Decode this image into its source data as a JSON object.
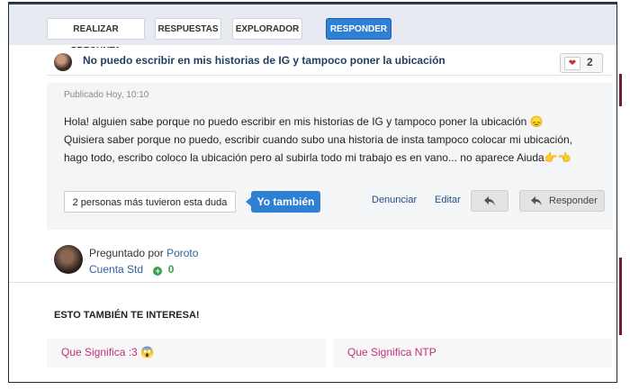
{
  "nav": {
    "ask": "REALIZAR PREGUNTA",
    "answers": "RESPUESTAS",
    "explorer": "EXPLORADOR",
    "respond": "RESPONDER"
  },
  "question": {
    "title": "No puedo escribir en mis historias de IG y tampoco poner la ubicación",
    "likes": "2",
    "published": "Publicado Hoy, 10:10",
    "body": [
      "Hola! alguien sabe porque no puedo escribir en mis historias de IG y tampoco poner la ubicación 😞",
      "Quisiera saber porque no puedo, escribir cuando subo una historia de insta tampoco colocar mi ubicación,",
      "hago todo, escribo coloco la ubicación pero al subirla todo mi trabajo es en vano... no aparece Aiuda👉👈"
    ]
  },
  "actions": {
    "same_doubt": "2 personas más tuvieron esta duda",
    "me_too": "Yo también",
    "report": "Denunciar",
    "edit": "Editar",
    "respond": "Responder"
  },
  "author": {
    "asked_by": "Preguntado por",
    "name": "Poroto",
    "account": "Cuenta Std",
    "points": "0"
  },
  "related": {
    "heading": "ESTO TAMBIÉN TE INTERESA!",
    "items": [
      "Que Significa :3 😱",
      "Que Significa NTP"
    ]
  },
  "icons": {
    "heart": "heart-icon",
    "reply": "reply-arrow-icon",
    "plus": "plus-circle-icon"
  },
  "colors": {
    "primary": "#2f7fd2",
    "link": "#1f4f87",
    "related_link": "#c2307a",
    "points": "#3aa04a"
  }
}
